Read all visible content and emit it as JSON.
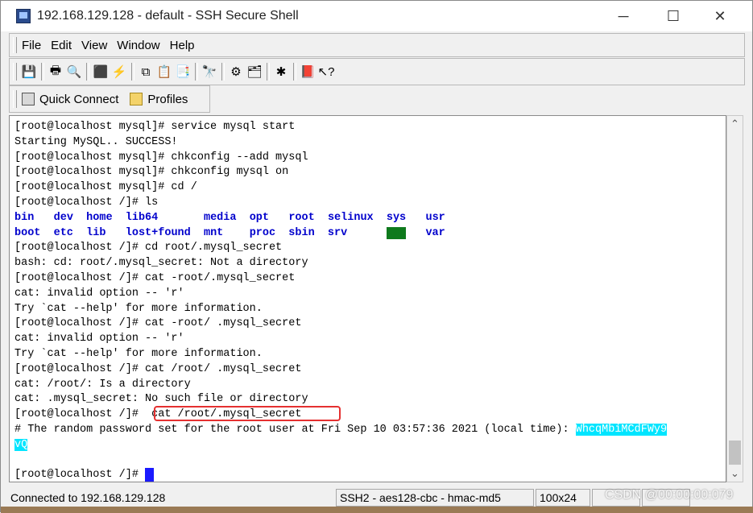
{
  "window": {
    "title": "192.168.129.128 - default - SSH Secure Shell",
    "controls": {
      "minimize": "─",
      "maximize": "☐",
      "close": "✕"
    }
  },
  "menu": {
    "items": [
      {
        "label": "File",
        "key": "F"
      },
      {
        "label": "Edit",
        "key": "E"
      },
      {
        "label": "View",
        "key": "V"
      },
      {
        "label": "Window",
        "key": "W"
      },
      {
        "label": "Help",
        "key": "H"
      }
    ]
  },
  "toolbar": {
    "groups": [
      [
        "save-icon"
      ],
      [
        "print-icon",
        "print-preview-icon"
      ],
      [
        "disconnect-icon",
        "connect-icon"
      ],
      [
        "copy-icon",
        "paste-icon",
        "paste-special-icon"
      ],
      [
        "find-icon"
      ],
      [
        "settings-icon",
        "profiles-icon"
      ],
      [
        "tools-icon"
      ],
      [
        "help-book-icon",
        "context-help-icon"
      ]
    ]
  },
  "quickbar": {
    "quick_connect": "Quick Connect",
    "profiles": "Profiles"
  },
  "terminal": {
    "lines": [
      "[root@localhost mysql]# service mysql start",
      "Starting MySQL.. SUCCESS!",
      "[root@localhost mysql]# chkconfig --add mysql",
      "[root@localhost mysql]# chkconfig mysql on",
      "[root@localhost mysql]# cd /",
      "[root@localhost /]# ls"
    ],
    "ls_row1": [
      "bin",
      "dev",
      "home",
      "lib64",
      "media",
      "opt",
      "root",
      "selinux",
      "sys",
      "usr"
    ],
    "ls_row2": [
      "boot",
      "etc",
      "lib",
      "lost+found",
      "mnt",
      "proc",
      "sbin",
      "srv",
      "tmp",
      "var"
    ],
    "lines2": [
      "[root@localhost /]# cd root/.mysql_secret",
      "bash: cd: root/.mysql_secret: Not a directory",
      "[root@localhost /]# cat -root/.mysql_secret",
      "cat: invalid option -- 'r'",
      "Try `cat --help' for more information.",
      "[root@localhost /]# cat -root/ .mysql_secret",
      "cat: invalid option -- 'r'",
      "Try `cat --help' for more information.",
      "[root@localhost /]# cat /root/ .mysql_secret",
      "cat: /root/: Is a directory",
      "cat: .mysql_secret: No such file or directory"
    ],
    "highlight_prompt": "[root@localhost /]# ",
    "highlight_cmd": " cat /root/.mysql_secret",
    "secret_prefix": "# The random password set for the root user at Fri Sep 10 03:57:36 2021 (local time): ",
    "secret_value_part1": "WhcqMbiMCdFWy9",
    "secret_value_part2": "vQ",
    "final_prompt": "[root@localhost /]# "
  },
  "status": {
    "connection": "Connected to 192.168.129.128",
    "cipher": "SSH2 - aes128-cbc - hmac-md5",
    "size": "100x24"
  },
  "watermark": "CSDN @00:00:00:079"
}
